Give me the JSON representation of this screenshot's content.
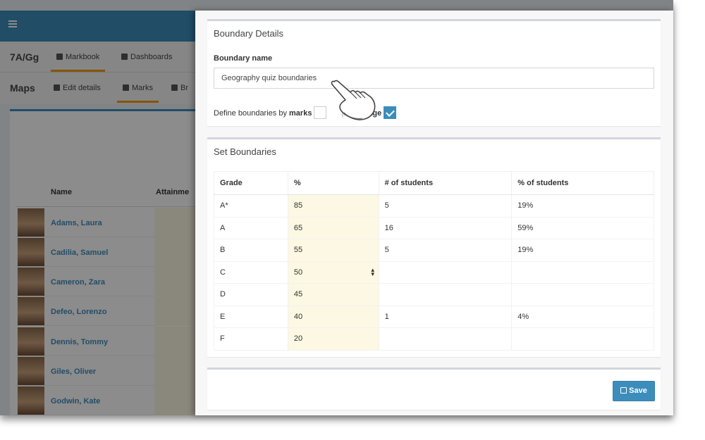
{
  "background": {
    "row1": {
      "title": "7A/Gg",
      "tabs": [
        {
          "label": "Markbook",
          "icon": "book-icon"
        },
        {
          "label": "Dashboards",
          "icon": "dashboard-icon"
        }
      ]
    },
    "row2": {
      "title": "Maps",
      "tabs": [
        {
          "label": "Edit details",
          "icon": "edit-icon"
        },
        {
          "label": "Marks",
          "icon": "book-icon"
        },
        {
          "label": "Br",
          "icon": "sitemap-icon"
        }
      ]
    },
    "list": {
      "headers": {
        "name": "Name",
        "attainment": "Attainme"
      },
      "students": [
        "Adams, Laura",
        "Cadilia, Samuel",
        "Cameron, Zara",
        "Defeo, Lorenzo",
        "Dennis, Tommy",
        "Giles, Oliver",
        "Godwin, Kate"
      ]
    }
  },
  "panel": {
    "details": {
      "title": "Boundary Details",
      "name_label": "Boundary name",
      "name_value": "Geography quiz boundaries",
      "define_prefix": "Define boundaries by",
      "define_marks": "marks",
      "define_pct_fragment": "perc",
      "define_pct_fragment2": "ntage"
    },
    "boundaries": {
      "title": "Set Boundaries",
      "headers": [
        "Grade",
        "%",
        "# of students",
        "% of students"
      ],
      "rows": [
        {
          "grade": "A*",
          "pct": "85",
          "students": "5",
          "pct_students": "19%"
        },
        {
          "grade": "A",
          "pct": "65",
          "students": "16",
          "pct_students": "59%"
        },
        {
          "grade": "B",
          "pct": "55",
          "students": "5",
          "pct_students": "19%"
        },
        {
          "grade": "C",
          "pct": "50",
          "students": "",
          "pct_students": ""
        },
        {
          "grade": "D",
          "pct": "45",
          "students": "",
          "pct_students": ""
        },
        {
          "grade": "E",
          "pct": "40",
          "students": "1",
          "pct_students": "4%"
        },
        {
          "grade": "F",
          "pct": "20",
          "students": "",
          "pct_students": ""
        }
      ]
    },
    "footer": {
      "save_label": "Save"
    }
  },
  "colors": {
    "primary": "#3c8dbc",
    "accent": "#f39c12",
    "cell_highlight": "#fcf8e3"
  }
}
